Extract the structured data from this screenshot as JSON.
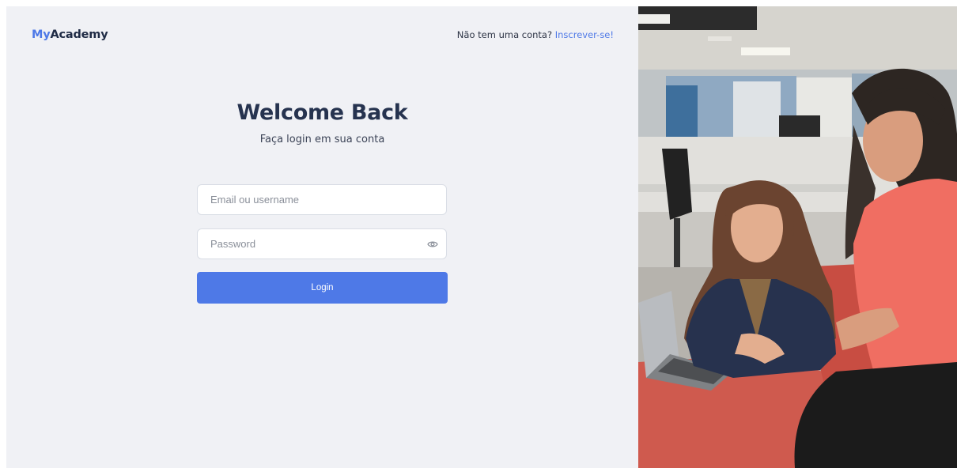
{
  "brand": {
    "prefix": "My",
    "suffix": "Academy"
  },
  "header": {
    "signup_prompt": "Não tem uma conta?",
    "signup_link": "Inscrever-se!"
  },
  "main": {
    "title": "Welcome Back",
    "subtitle": "Faça login em sua conta"
  },
  "form": {
    "email_placeholder": "Email ou username",
    "email_value": "",
    "password_placeholder": "Password",
    "password_value": "",
    "password_toggle_icon": "eye-icon",
    "login_label": "Login"
  },
  "hero": {
    "description_icon": "photo-two-women-laptop"
  },
  "colors": {
    "accent": "#4e79e7",
    "panel_bg": "#f0f1f5",
    "title": "#26334f"
  }
}
